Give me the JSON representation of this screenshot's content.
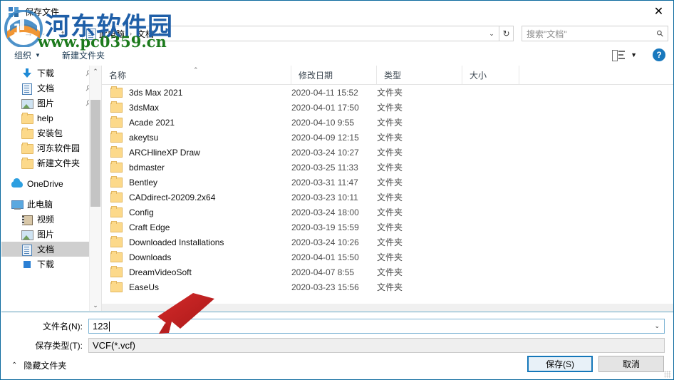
{
  "window": {
    "title": "保存文件",
    "close_label": "✕"
  },
  "nav": {
    "back_icon": "back-arrow",
    "forward_icon": "forward-arrow",
    "up_icon": "up-arrow",
    "refresh_label": "↻",
    "breadcrumbs": [
      "此电脑",
      "文档"
    ],
    "separator": "›",
    "dropdown_caret": "⌄"
  },
  "search": {
    "placeholder": "搜索\"文档\"",
    "icon": "search-icon"
  },
  "toolbar": {
    "organize_label": "组织",
    "organize_caret": "▼",
    "new_folder_label": "新建文件夹",
    "view_caret": "▼",
    "help_label": "?"
  },
  "sidebar": {
    "groups": [
      {
        "items": [
          {
            "label": "下载",
            "icon": "download-icon",
            "pinned": true,
            "indent": 1,
            "selected": false
          },
          {
            "label": "文档",
            "icon": "document-icon",
            "pinned": true,
            "indent": 1,
            "selected": false
          },
          {
            "label": "图片",
            "icon": "picture-icon",
            "pinned": true,
            "indent": 1,
            "selected": false
          },
          {
            "label": "help",
            "icon": "folder-icon",
            "pinned": false,
            "indent": 1,
            "selected": false
          },
          {
            "label": "安装包",
            "icon": "folder-icon",
            "pinned": false,
            "indent": 1,
            "selected": false
          },
          {
            "label": "河东软件园",
            "icon": "folder-icon",
            "pinned": false,
            "indent": 1,
            "selected": false
          },
          {
            "label": "新建文件夹",
            "icon": "folder-icon",
            "pinned": false,
            "indent": 1,
            "selected": false
          }
        ]
      },
      {
        "items": [
          {
            "label": "OneDrive",
            "icon": "onedrive-icon",
            "pinned": false,
            "indent": 0,
            "selected": false
          }
        ]
      },
      {
        "items": [
          {
            "label": "此电脑",
            "icon": "pc-icon",
            "pinned": false,
            "indent": 0,
            "selected": false
          },
          {
            "label": "视频",
            "icon": "video-icon",
            "pinned": false,
            "indent": 1,
            "selected": false
          },
          {
            "label": "图片",
            "icon": "picture-icon",
            "pinned": false,
            "indent": 1,
            "selected": false
          },
          {
            "label": "文档",
            "icon": "document-icon",
            "pinned": false,
            "indent": 1,
            "selected": true
          },
          {
            "label": "下载",
            "icon": "blue-square-icon",
            "pinned": false,
            "indent": 1,
            "selected": false
          }
        ]
      }
    ],
    "scroll_up": "⌃",
    "scroll_down": "⌄",
    "pin_icon": "pin-icon"
  },
  "filelist": {
    "columns": [
      "名称",
      "修改日期",
      "类型",
      "大小"
    ],
    "sort_indicator": "⌃",
    "rows": [
      {
        "name": "3ds Max 2021",
        "date": "2020-04-11 15:52",
        "type": "文件夹",
        "size": ""
      },
      {
        "name": "3dsMax",
        "date": "2020-04-01 17:50",
        "type": "文件夹",
        "size": ""
      },
      {
        "name": "Acade 2021",
        "date": "2020-04-10 9:55",
        "type": "文件夹",
        "size": ""
      },
      {
        "name": "akeytsu",
        "date": "2020-04-09 12:15",
        "type": "文件夹",
        "size": ""
      },
      {
        "name": "ARCHlineXP Draw",
        "date": "2020-03-24 10:27",
        "type": "文件夹",
        "size": ""
      },
      {
        "name": "bdmaster",
        "date": "2020-03-25 11:33",
        "type": "文件夹",
        "size": ""
      },
      {
        "name": "Bentley",
        "date": "2020-03-31 11:47",
        "type": "文件夹",
        "size": ""
      },
      {
        "name": "CADdirect-20209.2x64",
        "date": "2020-03-23 10:11",
        "type": "文件夹",
        "size": ""
      },
      {
        "name": "Config",
        "date": "2020-03-24 18:00",
        "type": "文件夹",
        "size": ""
      },
      {
        "name": "Craft Edge",
        "date": "2020-03-19 15:59",
        "type": "文件夹",
        "size": ""
      },
      {
        "name": "Downloaded Installations",
        "date": "2020-03-24 10:26",
        "type": "文件夹",
        "size": ""
      },
      {
        "name": "Downloads",
        "date": "2020-04-01 15:50",
        "type": "文件夹",
        "size": ""
      },
      {
        "name": "DreamVideoSoft",
        "date": "2020-04-07 8:55",
        "type": "文件夹",
        "size": ""
      },
      {
        "name": "EaseUs",
        "date": "2020-03-23 15:56",
        "type": "文件夹",
        "size": ""
      }
    ]
  },
  "form": {
    "filename_label": "文件名(N):",
    "filename_value": "123",
    "filetype_label": "保存类型(T):",
    "filetype_value": "VCF(*.vcf)"
  },
  "footer": {
    "hide_folders_label": "隐藏文件夹",
    "hide_folders_caret": "⌃",
    "save_label": "保存(S)",
    "cancel_label": "取消"
  },
  "watermark": {
    "site_name": "河东软件园",
    "site_url": "www.pc0359.cn"
  },
  "colors": {
    "accent": "#1577b9",
    "border": "#0d6a9e",
    "selection": "#cfcfcf",
    "folder": "#fcd98a",
    "annotation_red": "#cc2222"
  }
}
